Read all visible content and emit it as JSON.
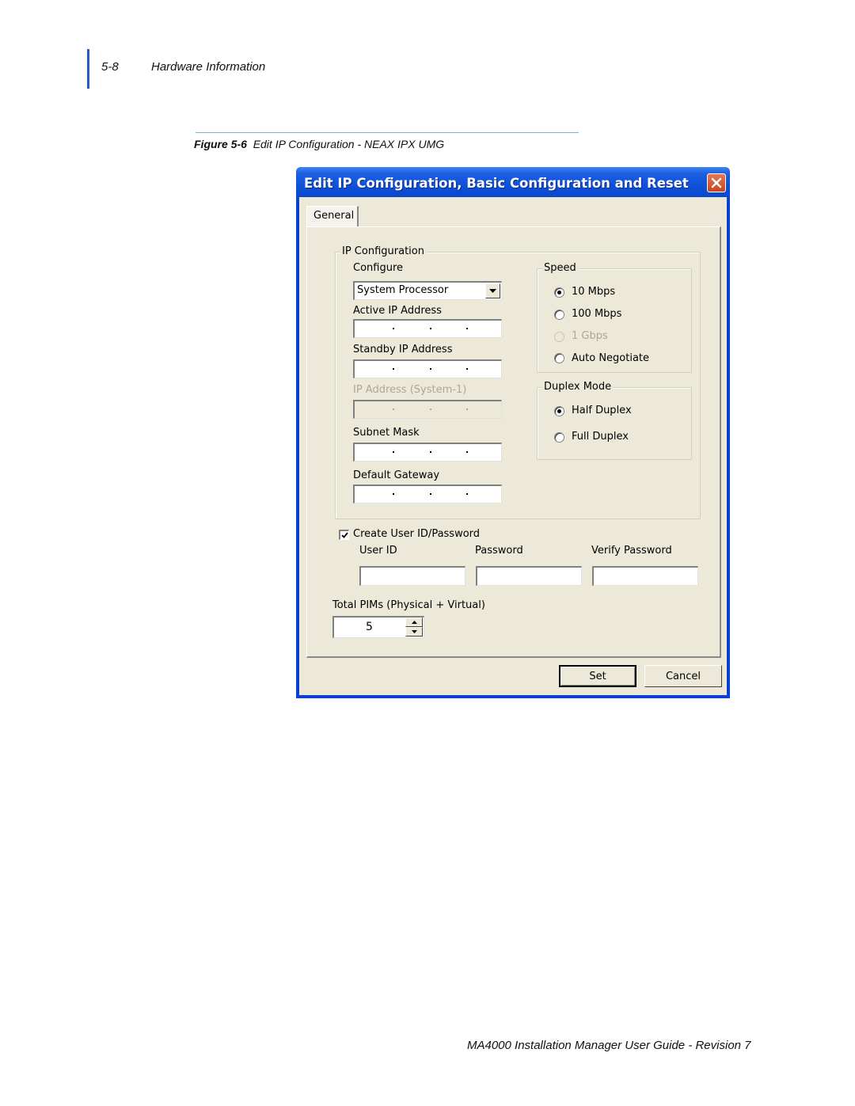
{
  "page_header": {
    "page_number": "5-8",
    "section": "Hardware Information"
  },
  "figure": {
    "label": "Figure 5-6",
    "caption": "Edit IP Configuration - NEAX IPX UMG"
  },
  "dialog": {
    "title": "Edit IP Configuration, Basic Configuration and Reset",
    "close_icon": "close-x-icon",
    "tabs": [
      {
        "label": "General",
        "active": true
      }
    ],
    "ip_configuration": {
      "group_label": "IP Configuration",
      "configure_label": "Configure",
      "configure_value": "System Processor",
      "active_ip_label": "Active IP Address",
      "active_ip_value": "",
      "standby_ip_label": "Standby IP Address",
      "standby_ip_value": "",
      "system1_ip_label": "IP Address (System-1)",
      "system1_ip_value": "",
      "system1_ip_disabled": true,
      "subnet_mask_label": "Subnet Mask",
      "subnet_mask_value": "",
      "default_gateway_label": "Default Gateway",
      "default_gateway_value": ""
    },
    "speed": {
      "group_label": "Speed",
      "options": [
        {
          "label": "10 Mbps",
          "checked": true,
          "disabled": false
        },
        {
          "label": "100 Mbps",
          "checked": false,
          "disabled": false
        },
        {
          "label": "1 Gbps",
          "checked": false,
          "disabled": true
        },
        {
          "label": "Auto Negotiate",
          "checked": false,
          "disabled": false
        }
      ]
    },
    "duplex": {
      "group_label": "Duplex Mode",
      "options": [
        {
          "label": "Half Duplex",
          "checked": true
        },
        {
          "label": "Full Duplex",
          "checked": false
        }
      ]
    },
    "credentials": {
      "checkbox_label": "Create User ID/Password",
      "checked": true,
      "user_id_label": "User ID",
      "user_id_value": "",
      "password_label": "Password",
      "password_value": "",
      "verify_password_label": "Verify Password",
      "verify_password_value": ""
    },
    "total_pims": {
      "label": "Total PIMs (Physical + Virtual)",
      "value": "5"
    },
    "buttons": {
      "set": "Set",
      "cancel": "Cancel"
    }
  },
  "footer": {
    "text": "MA4000 Installation Manager User Guide - Revision 7"
  }
}
